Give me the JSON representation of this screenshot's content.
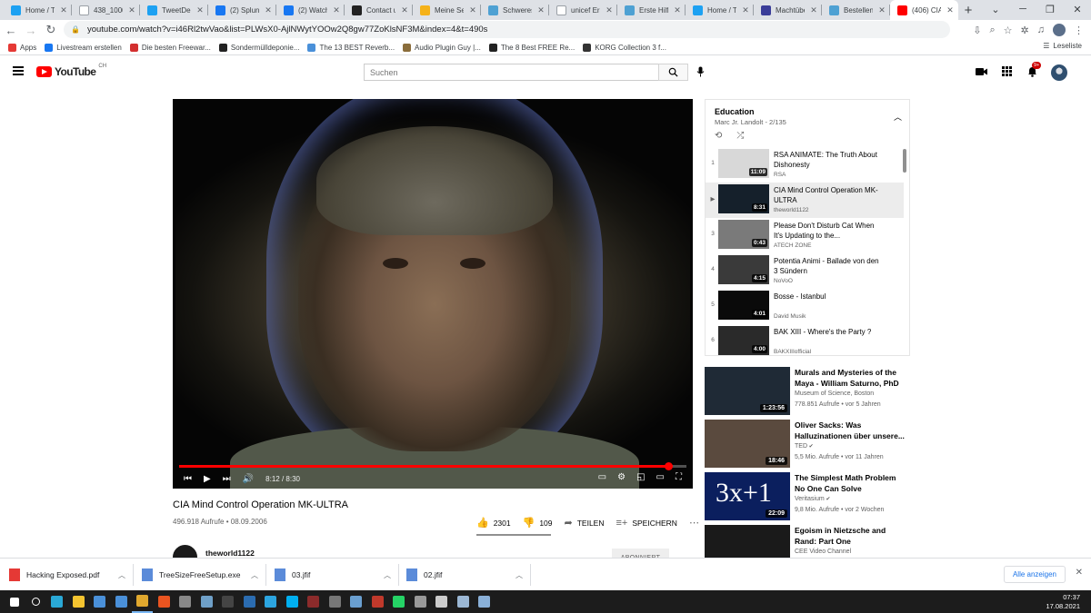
{
  "browser": {
    "tabs": [
      {
        "title": "Home / T",
        "icon": "twitter-icon",
        "color": "#1da1f2"
      },
      {
        "title": "438_1000",
        "icon": "google-icon",
        "color": "#ffffff"
      },
      {
        "title": "TweetDec",
        "icon": "tweetdeck-icon",
        "color": "#1da1f2"
      },
      {
        "title": "(2) Splunl",
        "icon": "facebook-icon",
        "color": "#1877f2"
      },
      {
        "title": "(2) Watch",
        "icon": "facebook-icon",
        "color": "#1877f2"
      },
      {
        "title": "Contact u",
        "icon": "site-icon",
        "color": "#222222"
      },
      {
        "title": "Meine Sei",
        "icon": "site-icon",
        "color": "#f5b21a"
      },
      {
        "title": "Schweres",
        "icon": "site-icon",
        "color": "#4ea1d3"
      },
      {
        "title": "unicef Ers",
        "icon": "google-icon",
        "color": "#ffffff"
      },
      {
        "title": "Erste Hilfe",
        "icon": "site-icon",
        "color": "#4ea1d3"
      },
      {
        "title": "Home / T",
        "icon": "twitter-icon",
        "color": "#1da1f2"
      },
      {
        "title": "Machtübe",
        "icon": "site-icon",
        "color": "#3a3d99"
      },
      {
        "title": "Bestellen",
        "icon": "site-icon",
        "color": "#4ea1d3"
      },
      {
        "title": "(406) CIA",
        "icon": "youtube-icon",
        "color": "#ff0000",
        "active": true
      }
    ],
    "url": "youtube.com/watch?v=i46Rl2twVao&list=PLWsX0-AjlNWytYOOw2Q8gw77ZoKlsNF3M&index=4&t=490s",
    "bookmarks": [
      {
        "label": "Apps",
        "color": "#e53935"
      },
      {
        "label": "Livestream erstellen",
        "color": "#1877f2"
      },
      {
        "label": "Die besten Freewar...",
        "color": "#d32f2f"
      },
      {
        "label": "Sondermülldeponie...",
        "color": "#222222"
      },
      {
        "label": "The 13 BEST Reverb...",
        "color": "#4a90d9"
      },
      {
        "label": "Audio Plugin Guy |...",
        "color": "#8a6d3b"
      },
      {
        "label": "The 8 Best FREE Re...",
        "color": "#222222"
      },
      {
        "label": "KORG Collection 3 f...",
        "color": "#333333"
      }
    ],
    "reading_list": "Leseliste"
  },
  "youtube": {
    "region": "CH",
    "search_placeholder": "Suchen",
    "notif_count": "9+",
    "player": {
      "current_time": "8:12",
      "duration": "8:30",
      "progress": 0.965
    },
    "video": {
      "title": "CIA Mind Control Operation MK-ULTRA",
      "meta": "496.918 Aufrufe • 08.09.2006",
      "likes": "2301",
      "dislikes": "109",
      "share": "TEILEN",
      "save": "SPEICHERN",
      "channel": "theworld1122",
      "subscribe": "ABONNIERT"
    },
    "playlist": {
      "title": "Education",
      "subtitle": "Marc Jr. Landolt - 2/135",
      "items": [
        {
          "idx": "1",
          "title": "RSA ANIMATE: The Truth About Dishonesty",
          "channel": "RSA",
          "duration": "11:09",
          "color": "#d8d8d8"
        },
        {
          "idx": "▶",
          "title": "CIA Mind Control Operation MK-ULTRA",
          "channel": "theworld1122",
          "duration": "8:31",
          "color": "#15202b",
          "active": true
        },
        {
          "idx": "3",
          "title": "Please Don't Disturb Cat When It's Updating to the...",
          "channel": "ATECH ZONE",
          "duration": "0:43",
          "color": "#7a7a7a"
        },
        {
          "idx": "4",
          "title": "Potentia Animi - Ballade von den 3 Sündern",
          "channel": "NoVoO",
          "duration": "4:15",
          "color": "#3a3a3a"
        },
        {
          "idx": "5",
          "title": "Bosse - Istanbul",
          "channel": "David Musik",
          "duration": "4:01",
          "color": "#0a0a0a"
        },
        {
          "idx": "6",
          "title": "BAK XIII - Where's the Party ?",
          "channel": "BAKXIIIofficial",
          "duration": "4:00",
          "color": "#2a2a2a"
        }
      ]
    },
    "recommendations": [
      {
        "title": "Murals and Mysteries of the Maya - William Saturno, PhD",
        "channel": "Museum of Science, Boston",
        "stats": "778.851 Aufrufe • vor 5 Jahren",
        "duration": "1:23:56",
        "color": "#1f2a36",
        "verified": false
      },
      {
        "title": "Oliver Sacks: Was Halluzinationen über unsere...",
        "channel": "TED",
        "stats": "5,5 Mio. Aufrufe • vor 11 Jahren",
        "duration": "18:46",
        "color": "#5a4a3e",
        "verified": true
      },
      {
        "title": "The Simplest Math Problem No One Can Solve",
        "channel": "Veritasium",
        "stats": "9,8 Mio. Aufrufe • vor 2 Wochen",
        "duration": "22:09",
        "color": "#0b1f5e",
        "verified": true,
        "thumb_text": "3x+1"
      },
      {
        "title": "Egoism in Nietzsche and Rand: Part One",
        "channel": "CEE Video Channel",
        "stats": "",
        "duration": "",
        "color": "#1a1a1a",
        "verified": false
      }
    ]
  },
  "downloads": {
    "items": [
      {
        "name": "Hacking Exposed.pdf",
        "color": "#e53935"
      },
      {
        "name": "TreeSizeFreeSetup.exe",
        "color": "#5b8bd9"
      },
      {
        "name": "03.jfif",
        "color": "#5b8bd9"
      },
      {
        "name": "02.jfif",
        "color": "#5b8bd9"
      }
    ],
    "show_all": "Alle anzeigen"
  },
  "taskbar": {
    "time": "07:37",
    "date": "17.08.2021",
    "apps": [
      {
        "name": "start-icon",
        "color": "#ffffff"
      },
      {
        "name": "search-icon",
        "color": "#ffffff"
      },
      {
        "name": "edge-icon",
        "color": "#2aa9d6"
      },
      {
        "name": "explorer-icon",
        "color": "#f4c430"
      },
      {
        "name": "store-icon",
        "color": "#4a90d9"
      },
      {
        "name": "mail-icon",
        "color": "#4a90d9"
      },
      {
        "name": "chrome-icon",
        "color": "#e0a82e"
      },
      {
        "name": "ubuntu-icon",
        "color": "#e95420"
      },
      {
        "name": "terminal-icon",
        "color": "#888888"
      },
      {
        "name": "app-icon",
        "color": "#6fa0c8"
      },
      {
        "name": "live-icon",
        "color": "#444444"
      },
      {
        "name": "app-icon",
        "color": "#2b6cb0"
      },
      {
        "name": "telegram-icon",
        "color": "#2ca5e0"
      },
      {
        "name": "skype-icon",
        "color": "#00aff0"
      },
      {
        "name": "app-icon",
        "color": "#8b2b2b"
      },
      {
        "name": "keyboard-icon",
        "color": "#777777"
      },
      {
        "name": "snipping-icon",
        "color": "#6a9fd0"
      },
      {
        "name": "app-icon",
        "color": "#c0392b"
      },
      {
        "name": "whatsapp-icon",
        "color": "#25d366"
      },
      {
        "name": "app-icon",
        "color": "#999999"
      },
      {
        "name": "app-icon",
        "color": "#cccccc"
      },
      {
        "name": "app-icon",
        "color": "#9bb7d4"
      },
      {
        "name": "calculator-icon",
        "color": "#8ab0d8"
      }
    ]
  }
}
